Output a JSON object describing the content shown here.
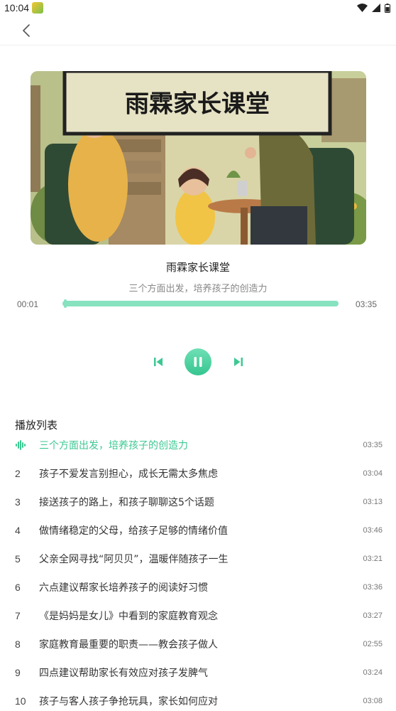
{
  "status_bar": {
    "time": "10:04",
    "icons": [
      "app-badge-icon",
      "wifi-icon",
      "signal-icon",
      "battery-icon"
    ]
  },
  "nav": {
    "back_icon": "chevron-left-icon"
  },
  "cover": {
    "text": "雨霖家长课堂"
  },
  "player": {
    "title": "雨霖家长课堂",
    "subtitle": "三个方面出发，培养孩子的创造力",
    "current_time": "00:01",
    "total_time": "03:35",
    "progress": 0.005,
    "state": "playing"
  },
  "colors": {
    "accent": "#3cc892",
    "progress": "#86e2bf"
  },
  "playlist": {
    "heading": "播放列表",
    "items": [
      {
        "index": "",
        "title": "三个方面出发，培养孩子的创造力",
        "duration": "03:35",
        "active": true
      },
      {
        "index": "2",
        "title": "孩子不爱发言别担心，成长无需太多焦虑",
        "duration": "03:04"
      },
      {
        "index": "3",
        "title": "接送孩子的路上，和孩子聊聊这5个话题",
        "duration": "03:13"
      },
      {
        "index": "4",
        "title": "做情绪稳定的父母，给孩子足够的情绪价值",
        "duration": "03:46"
      },
      {
        "index": "5",
        "title": "父亲全网寻找“阿贝贝”，温暖伴随孩子一生",
        "duration": "03:21"
      },
      {
        "index": "6",
        "title": "六点建议帮家长培养孩子的阅读好习惯",
        "duration": "03:36"
      },
      {
        "index": "7",
        "title": "《是妈妈是女儿》中看到的家庭教育观念",
        "duration": "03:27"
      },
      {
        "index": "8",
        "title": "家庭教育最重要的职责——教会孩子做人",
        "duration": "02:55"
      },
      {
        "index": "9",
        "title": "四点建议帮助家长有效应对孩子发脾气",
        "duration": "03:24"
      },
      {
        "index": "10",
        "title": "孩子与客人孩子争抢玩具，家长如何应对",
        "duration": "03:08"
      }
    ]
  }
}
